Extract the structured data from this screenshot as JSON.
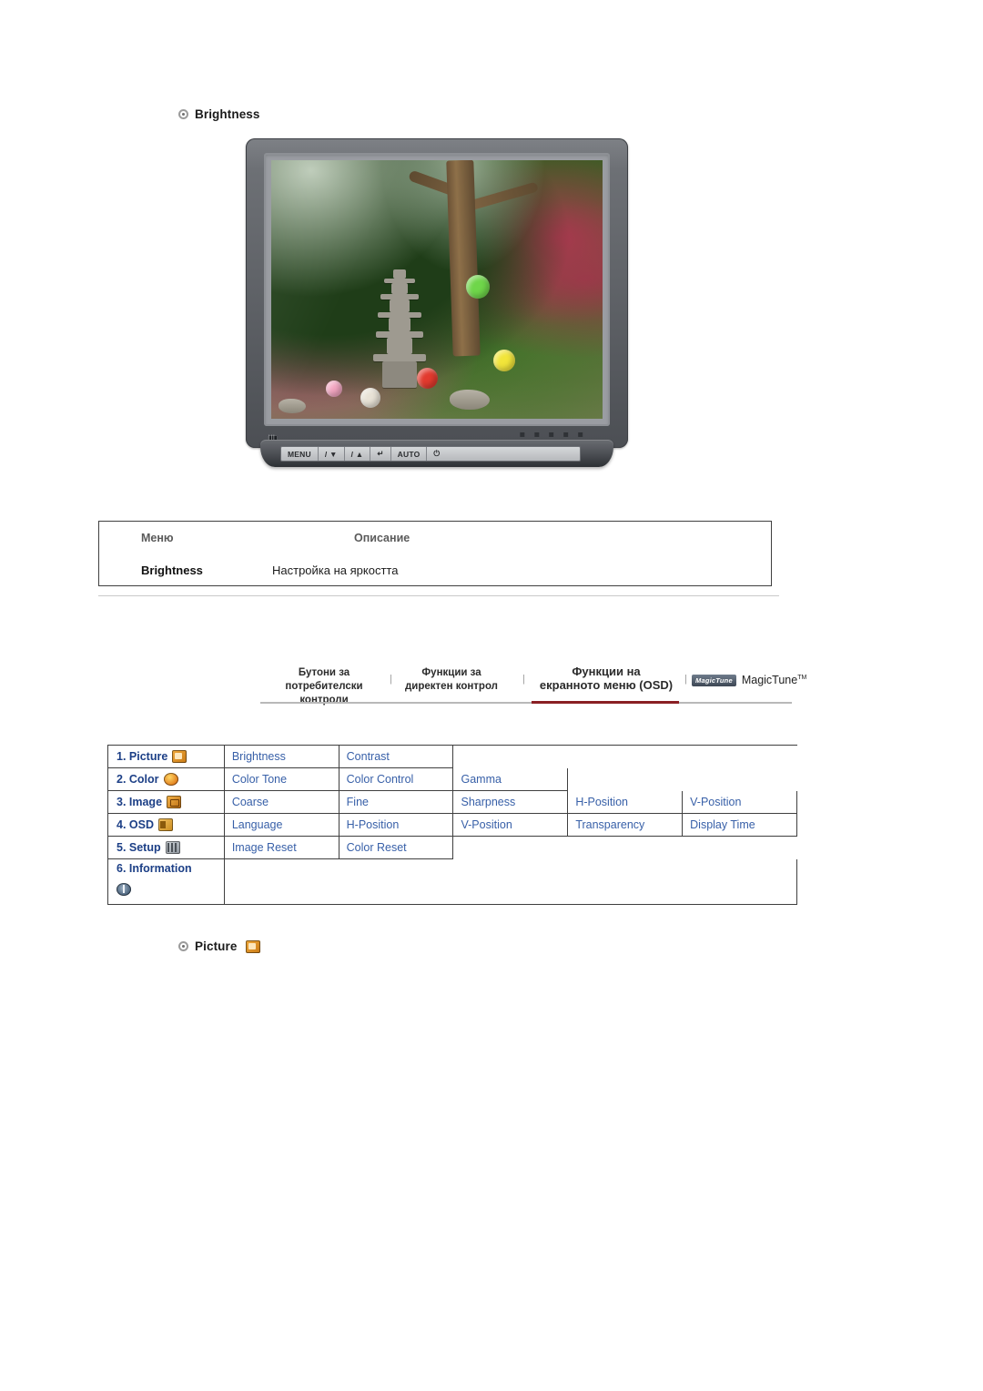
{
  "sections": {
    "brightness_heading": "Brightness",
    "picture_heading": "Picture"
  },
  "monitor": {
    "buttons": [
      "MENU",
      "▼",
      "▲",
      "↵",
      "AUTO",
      "⏻"
    ],
    "button_labels": {
      "menu": "MENU",
      "down": "/ ▼",
      "up": "/ ▲",
      "enter": "↵",
      "auto": "AUTO",
      "power": "⏻"
    },
    "brand_dots": "▪ ▪ ▪ ▪ ▪"
  },
  "desc_table": {
    "headers": {
      "menu": "Меню",
      "description": "Описание"
    },
    "rows": [
      {
        "menu": "Brightness",
        "description": "Настройка на яркостта"
      }
    ]
  },
  "tabs": {
    "tab1": {
      "line1": "Бутони за",
      "line2": "потребителски контроли"
    },
    "tab2": {
      "line1": "Функции за",
      "line2": "директен контрол"
    },
    "tab3": {
      "line1": "Функции на",
      "line2": "екранното меню (OSD)"
    },
    "tab4": {
      "badge": "MagicTune",
      "text": "MagicTune",
      "sup": "TM"
    },
    "separator": "|",
    "active_color": "#8a1f24"
  },
  "osd_grid": {
    "rows": [
      {
        "label": "1. Picture",
        "icon": "picture-icon",
        "items": [
          "Brightness",
          "Contrast"
        ]
      },
      {
        "label": "2. Color",
        "icon": "color-icon",
        "items": [
          "Color Tone",
          "Color Control",
          "Gamma"
        ]
      },
      {
        "label": "3. Image",
        "icon": "image-icon",
        "items": [
          "Coarse",
          "Fine",
          "Sharpness",
          "H-Position",
          "V-Position"
        ]
      },
      {
        "label": "4. OSD",
        "icon": "osd-icon",
        "items": [
          "Language",
          "H-Position",
          "V-Position",
          "Transparency",
          "Display Time"
        ]
      },
      {
        "label": "5. Setup",
        "icon": "setup-icon",
        "items": [
          "Image Reset",
          "Color Reset"
        ]
      },
      {
        "label": "6. Information",
        "icon": "information-icon",
        "items": []
      }
    ],
    "link_color": "#3860a8"
  }
}
